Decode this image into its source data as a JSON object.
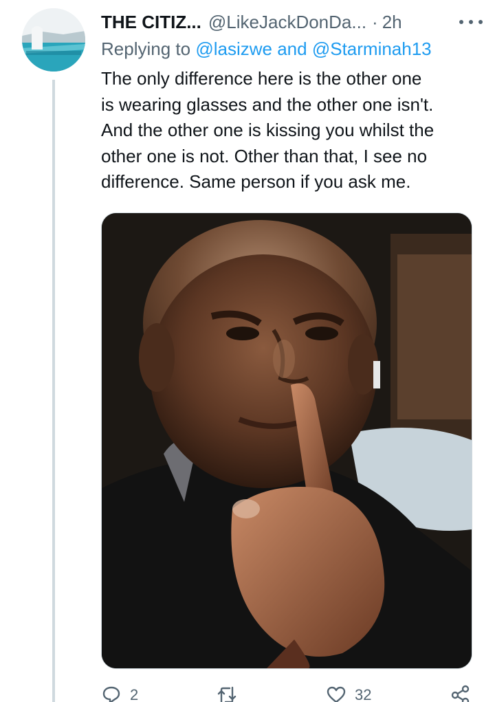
{
  "tweet": {
    "display_name": "THE CITIZ...",
    "handle": "@LikeJackDonDa...",
    "separator": "·",
    "time": "2h",
    "reply_prefix": "Replying to",
    "reply_mention_1": "@lasizwe",
    "reply_and": "and",
    "reply_mention_2": "@Starminah13",
    "text_lines": [
      "The only difference  here is  the other one",
      "is wearing glasses and the other one  isn't.",
      "And the other one is kissing you whilst the",
      "other one is not. Other than that, I see no",
      "difference. Same person if you ask me."
    ]
  },
  "actions": {
    "reply_count": "2",
    "like_count": "32"
  },
  "icons": {
    "more": "more-horizontal-icon",
    "reply": "reply-icon",
    "retweet": "retweet-icon",
    "like": "heart-icon",
    "share": "share-icon"
  },
  "colors": {
    "mention": "#1d9bf0",
    "secondary_text": "#536471",
    "thread_line": "#cfd9de"
  }
}
